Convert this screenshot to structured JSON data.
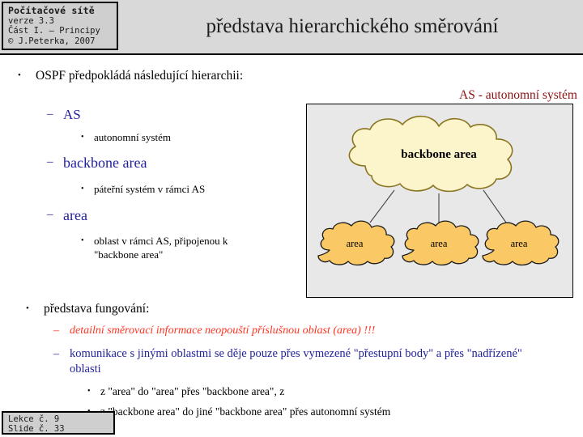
{
  "header": {
    "course_title": "Počítačové sítě",
    "version": "verze 3.3",
    "part": "Část I. – Principy",
    "copyright": "© J.Peterka, 2007",
    "slide_title": "představa hierarchického směrování"
  },
  "content": {
    "b1": {
      "marker": "•",
      "text": "OSPF předpokládá následující hierarchii:"
    },
    "b1_as": {
      "marker": "–",
      "text": "AS"
    },
    "b1_as_sub": {
      "marker": "•",
      "text": "autonomní systém"
    },
    "b1_backbone": {
      "marker": "–",
      "text": "backbone area"
    },
    "b1_backbone_sub": {
      "marker": "•",
      "text": "páteřní systém v rámci AS"
    },
    "b1_area": {
      "marker": "–",
      "text": "area"
    },
    "b1_area_sub": {
      "marker": "•",
      "text": "oblast v rámci AS, připojenou k \"backbone area\""
    },
    "b2": {
      "marker": "•",
      "text": "představa fungování:"
    },
    "b2_s1": {
      "marker": "–",
      "text": "detailní směrovací informace neopouští příslušnou oblast (area) !!!"
    },
    "b2_s2": {
      "marker": "–",
      "text": "komunikace s jinými oblastmi se děje pouze přes vymezené \"přestupní body\" a přes \"nadřízené\" oblasti"
    },
    "b2_s2_a": {
      "marker": "•",
      "text": "z \"area\" do \"area\" přes \"backbone area\", z"
    },
    "b2_s2_b": {
      "marker": "•",
      "text": "z \"backbone area\" do jiné \"backbone area\" přes autonomní systém"
    }
  },
  "diagram": {
    "as_label": "AS - autonomní systém",
    "backbone_label": "backbone area",
    "area_1_label": "area",
    "area_2_label": "area",
    "area_3_label": "area",
    "colors": {
      "panel_background": "#e8e8e8",
      "panel_border": "#000000",
      "backbone_fill": "#fcf5cc",
      "backbone_stroke": "#8a7420",
      "area_fill": "#fac864",
      "area_stroke": "#1a1a1a",
      "connector": "#444444",
      "as_label_color": "#8b1212"
    }
  },
  "footer": {
    "lecture": "Lekce č. 9",
    "slide": "Slide č. 33"
  }
}
